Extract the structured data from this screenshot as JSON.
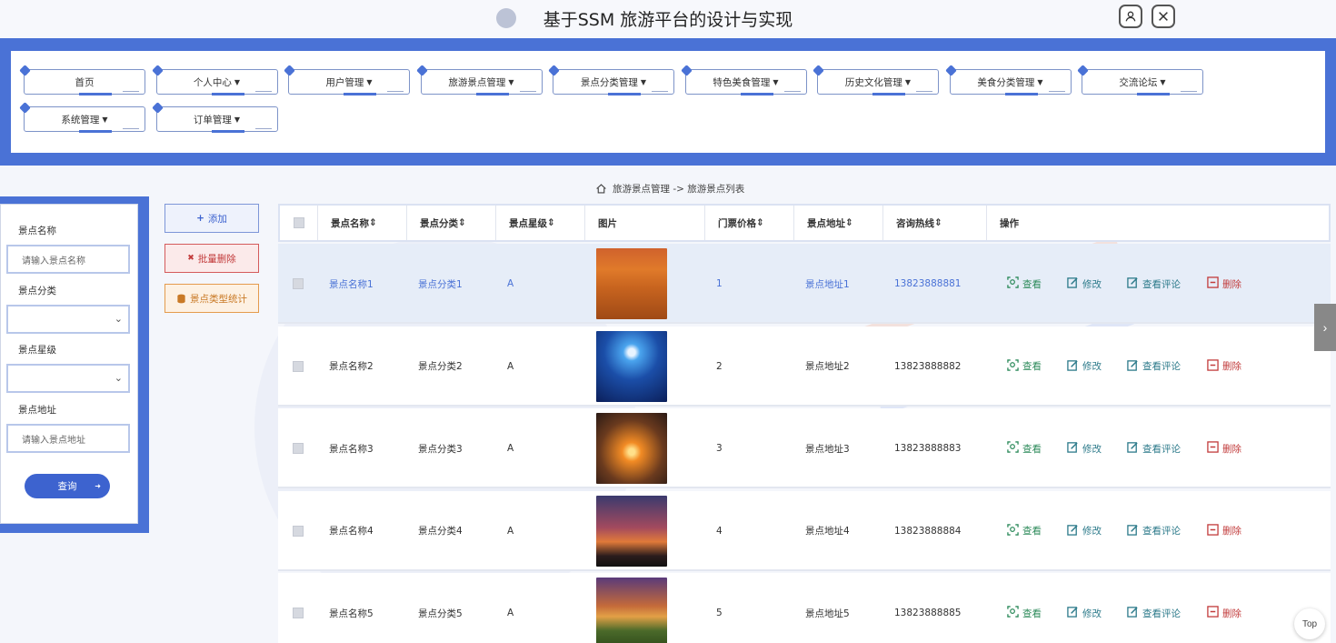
{
  "header": {
    "title": "基于SSM 旅游平台的设计与实现",
    "user_icon": "user-icon",
    "close_icon": "close-icon"
  },
  "nav": {
    "items": [
      {
        "label": "首页",
        "dropdown": false
      },
      {
        "label": "个人中心",
        "dropdown": true
      },
      {
        "label": "用户管理",
        "dropdown": true
      },
      {
        "label": "旅游景点管理",
        "dropdown": true
      },
      {
        "label": "景点分类管理",
        "dropdown": true
      },
      {
        "label": "特色美食管理",
        "dropdown": true
      },
      {
        "label": "历史文化管理",
        "dropdown": true
      },
      {
        "label": "美食分类管理",
        "dropdown": true
      },
      {
        "label": "交流论坛",
        "dropdown": true
      },
      {
        "label": "系统管理",
        "dropdown": true
      },
      {
        "label": "订单管理",
        "dropdown": true
      }
    ]
  },
  "breadcrumb": {
    "icon": "home-icon",
    "path": "旅游景点管理 -> 旅游景点列表"
  },
  "search": {
    "name_label": "景点名称",
    "name_placeholder": "请输入景点名称",
    "category_label": "景点分类",
    "category_value": "",
    "level_label": "景点星级",
    "level_value": "",
    "address_label": "景点地址",
    "address_placeholder": "请输入景点地址",
    "query_button": "查询"
  },
  "actions": {
    "add": "添加",
    "batch_delete": "批量删除",
    "stats": "景点类型统计"
  },
  "table": {
    "headers": [
      "景点名称",
      "景点分类",
      "景点星级",
      "图片",
      "门票价格",
      "景点地址",
      "咨询热线",
      "操作"
    ],
    "ops": {
      "view": "查看",
      "edit": "修改",
      "comments": "查看评论",
      "delete": "删除"
    },
    "rows": [
      {
        "name": "景点名称1",
        "category": "景点分类1",
        "level": "A",
        "price": "1",
        "address": "景点地址1",
        "phone": "13823888881"
      },
      {
        "name": "景点名称2",
        "category": "景点分类2",
        "level": "A",
        "price": "2",
        "address": "景点地址2",
        "phone": "13823888882"
      },
      {
        "name": "景点名称3",
        "category": "景点分类3",
        "level": "A",
        "price": "3",
        "address": "景点地址3",
        "phone": "13823888883"
      },
      {
        "name": "景点名称4",
        "category": "景点分类4",
        "level": "A",
        "price": "4",
        "address": "景点地址4",
        "phone": "13823888884"
      },
      {
        "name": "景点名称5",
        "category": "景点分类5",
        "level": "A",
        "price": "5",
        "address": "景点地址5",
        "phone": "13823888885"
      }
    ]
  },
  "misc": {
    "top_button": "Top",
    "next_arrow": "›"
  },
  "colors": {
    "accent": "#4a72d6",
    "danger": "#c23b3b",
    "warning": "#e49b4d",
    "success": "#2c8a5a"
  }
}
